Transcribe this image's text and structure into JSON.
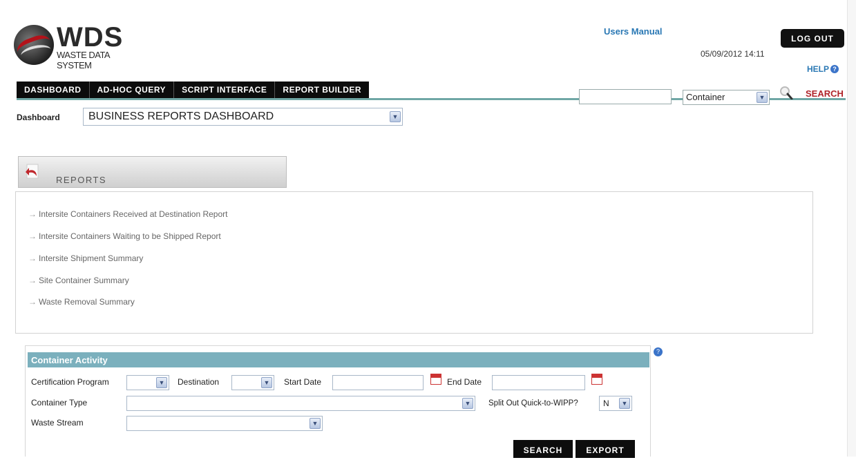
{
  "header": {
    "logo_title": "WDS",
    "logo_subtitle": "WASTE DATA SYSTEM",
    "users_manual": "Users Manual",
    "datetime": "05/09/2012 14:11",
    "logout": "LOG OUT",
    "help": "HELP"
  },
  "nav": {
    "tabs": [
      "DASHBOARD",
      "AD-HOC QUERY",
      "SCRIPT INTERFACE",
      "REPORT BUILDER"
    ],
    "search_type": "Container",
    "search_label": "SEARCH"
  },
  "dashboard": {
    "label": "Dashboard",
    "selected": "BUSINESS REPORTS DASHBOARD"
  },
  "reports": {
    "title": "REPORTS",
    "items": [
      "Intersite Containers Received at Destination Report",
      "Intersite Containers Waiting to be Shipped Report",
      "Intersite Shipment Summary",
      "Site Container Summary",
      "Waste Removal Summary"
    ]
  },
  "container_activity": {
    "title": "Container Activity",
    "certification_program_label": "Certification Program",
    "destination_label": "Destination",
    "start_date_label": "Start Date",
    "end_date_label": "End Date",
    "container_type_label": "Container Type",
    "split_out_label": "Split Out Quick-to-WIPP?",
    "split_out_value": "N",
    "waste_stream_label": "Waste Stream",
    "search_button": "SEARCH",
    "export_button": "EXPORT"
  }
}
